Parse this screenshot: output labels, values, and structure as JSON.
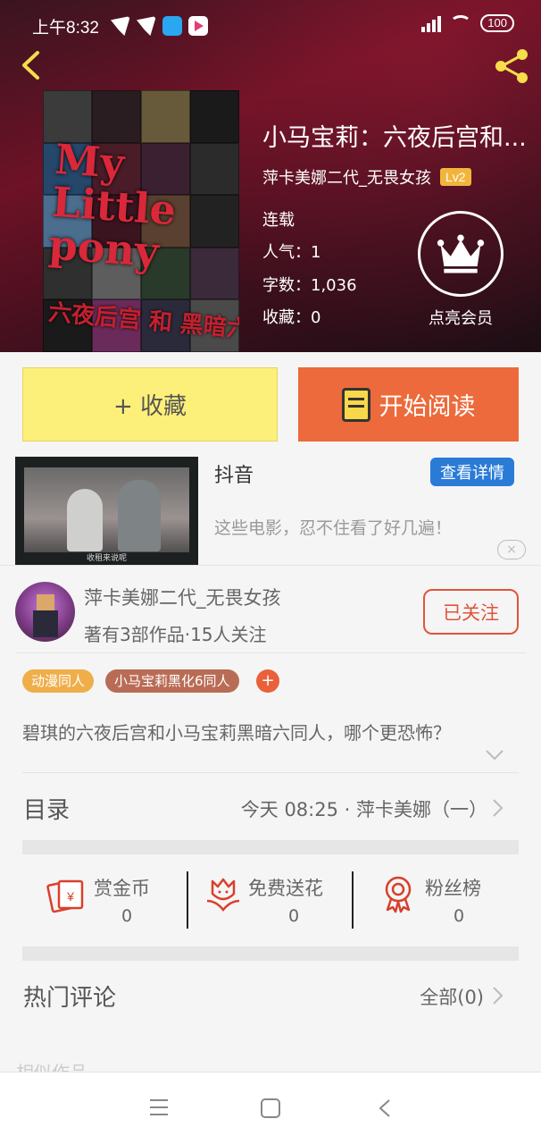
{
  "status": {
    "time": "上午8:32",
    "battery": "100"
  },
  "book": {
    "title": "小马宝莉：六夜后宫和...",
    "author": "萍卡美娜二代_无畏女孩",
    "level": "Lv2",
    "status": "连载",
    "popularity": "人气：1",
    "word_count": "字数：1,036",
    "collections": "收藏：0",
    "cover_title": "My Little pony",
    "cover_subtitle": "六夜后宫 和 黑暗六同人"
  },
  "vip": {
    "label": "点亮会员"
  },
  "actions": {
    "collect_label": "+ 收藏",
    "read_label": "开始阅读"
  },
  "ad": {
    "title": "抖音",
    "detail_label": "查看详情",
    "description": "这些电影，忍不住看了好几遍！",
    "caption": "收租来说呢",
    "close": "×"
  },
  "author_card": {
    "name": "萍卡美娜二代_无畏女孩",
    "stats": "著有3部作品·15人关注",
    "follow_label": "已关注"
  },
  "tags": [
    "动漫同人",
    "小马宝莉黑化6同人"
  ],
  "tag_add": "+",
  "summary": "碧琪的六夜后宫和小马宝莉黑暗六同人，哪个更恐怖？",
  "catalog": {
    "label": "目录",
    "latest": "今天 08:25 · 萍卡美娜（一）"
  },
  "stats": [
    {
      "label": "赏金币",
      "value": "0"
    },
    {
      "label": "免费送花",
      "value": "0"
    },
    {
      "label": "粉丝榜",
      "value": "0"
    }
  ],
  "comments": {
    "label": "热门评论",
    "all_label": "全部(0)"
  },
  "similar": {
    "label": "相似作品"
  },
  "colors": {
    "accent": "#ec6a3b",
    "collect": "#fdf07a",
    "level": "#f2b53c",
    "link_blue": "#2a7bd6",
    "icon_red": "#d8402c"
  }
}
